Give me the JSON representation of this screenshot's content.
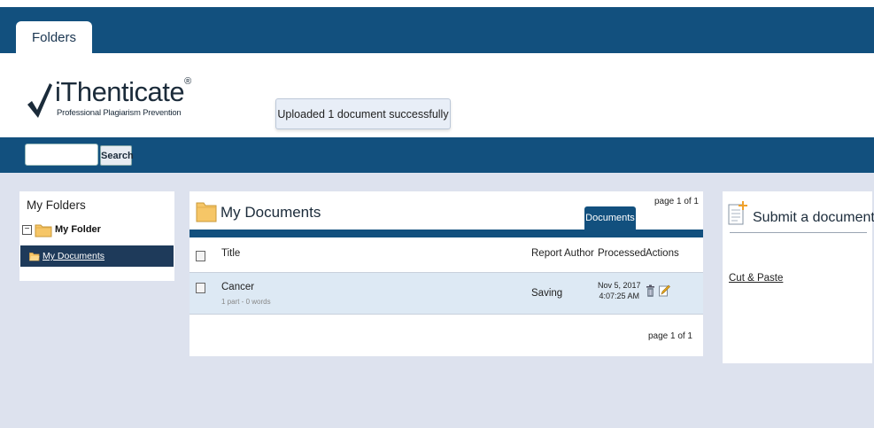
{
  "nav": {
    "tab_folders": "Folders"
  },
  "brand": {
    "name": "iThenticate",
    "registered": "®",
    "tagline": "Professional Plagiarism Prevention"
  },
  "notice": {
    "message": "Uploaded 1 document successfully"
  },
  "search": {
    "placeholder": "",
    "button_label": "Search"
  },
  "sidebar": {
    "title": "My Folders",
    "root": {
      "toggle": "−",
      "label": "My Folder"
    },
    "child": {
      "label": "My Documents"
    }
  },
  "documents": {
    "title": "My Documents",
    "tab": "Documents",
    "page_top": "page 1 of 1",
    "page_bottom": "page 1 of 1",
    "columns": {
      "title": "Title",
      "report": "Report",
      "author": "Author",
      "processed": "Processed",
      "actions": "Actions"
    },
    "rows": [
      {
        "title": "Cancer",
        "meta": "1 part - 0 words",
        "report": "Saving",
        "author": "",
        "processed_date": "Nov 5, 2017",
        "processed_time": "4:07:25 AM"
      }
    ]
  },
  "submit": {
    "title": "Submit a document",
    "cut_paste": "Cut & Paste"
  },
  "colors": {
    "primary": "#12507e",
    "background": "#dde2ee",
    "row_highlight": "#dde9f4",
    "folder": "#f6c667"
  }
}
